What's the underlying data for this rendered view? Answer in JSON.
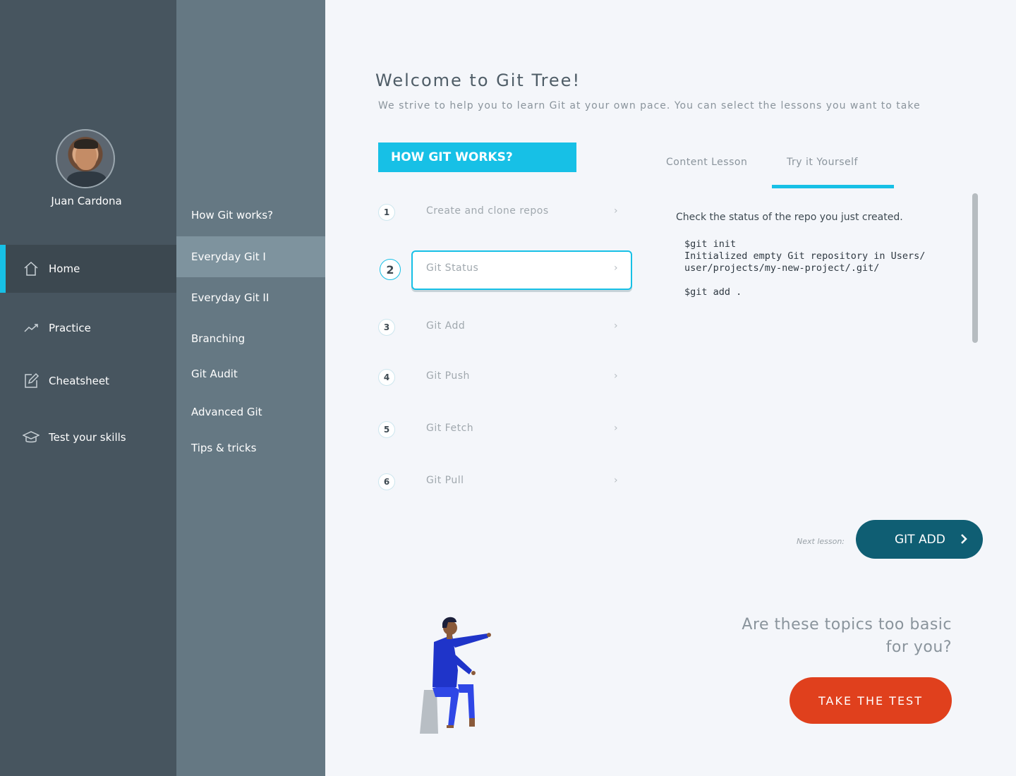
{
  "user": {
    "name": "Juan Cardona"
  },
  "sidebar": {
    "items": [
      {
        "label": "Home",
        "icon": "home-icon",
        "active": true
      },
      {
        "label": "Practice",
        "icon": "trend-icon",
        "active": false
      },
      {
        "label": "Cheatsheet",
        "icon": "edit-icon",
        "active": false
      },
      {
        "label": "Test your skills",
        "icon": "graduation-cap-icon",
        "active": false
      }
    ]
  },
  "subnav": {
    "items": [
      {
        "label": "How Git works?"
      },
      {
        "label": "Everyday Git I",
        "active": true
      },
      {
        "label": "Everyday Git II"
      },
      {
        "label": "Branching"
      },
      {
        "label": "Git Audit"
      },
      {
        "label": "Advanced Git"
      },
      {
        "label": "Tips & tricks"
      }
    ]
  },
  "main": {
    "title": "Welcome to Git Tree!",
    "subtitle": "We strive to help you to learn Git at your own pace. You can select  the  lessons you want to take",
    "section_header": "HOW GIT WORKS?",
    "lessons": [
      {
        "num": "1",
        "label": "Create and clone repos"
      },
      {
        "num": "2",
        "label": "Git Status",
        "active": true
      },
      {
        "num": "3",
        "label": "Git Add"
      },
      {
        "num": "4",
        "label": "Git Push"
      },
      {
        "num": "5",
        "label": "Git Fetch"
      },
      {
        "num": "6",
        "label": "Git Pull"
      }
    ],
    "tabs": [
      {
        "label": "Content Lesson"
      },
      {
        "label": "Try it Yourself",
        "active": true
      }
    ],
    "content": {
      "intro": "Check the status of the repo you just created.",
      "code": "$git init\nInitialized empty Git repository in Users/\nuser/projects/my-new-project/.git/\n\n$git add ."
    },
    "next_label": "Next lesson:",
    "next_button": "GIT ADD",
    "basic_question": "Are these topics too basic for you?",
    "test_button": "TAKE THE TEST"
  },
  "colors": {
    "accent": "#17c0e6",
    "primary_dark": "#0f5e73",
    "cta": "#e0401d",
    "sidebar": "#47555f",
    "subnav": "#657883"
  }
}
